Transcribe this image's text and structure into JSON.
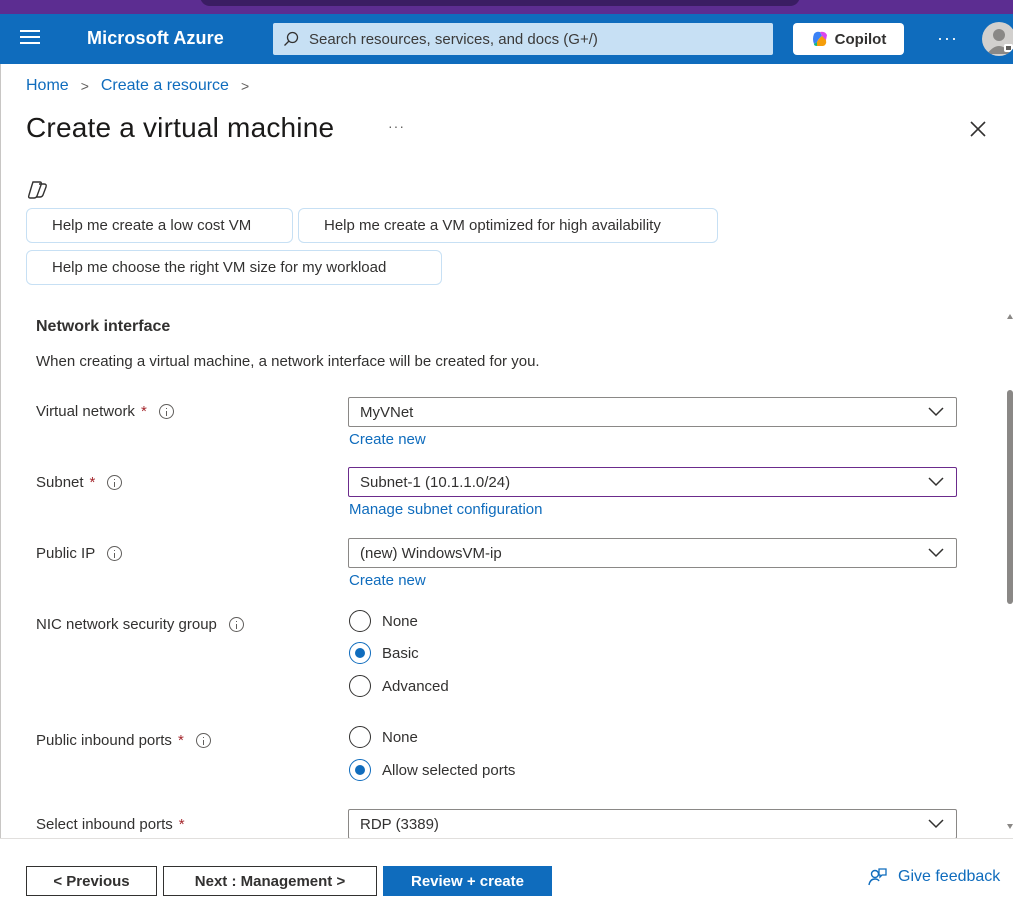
{
  "header": {
    "brand": "Microsoft Azure",
    "search_placeholder": "Search resources, services, and docs (G+/)",
    "copilot_label": "Copilot",
    "more_label": "···"
  },
  "breadcrumb": {
    "items": [
      "Home",
      "Create a resource"
    ]
  },
  "page": {
    "title": "Create a virtual machine",
    "more_label": "···"
  },
  "suggestions": [
    "Help me create a low cost VM",
    "Help me create a VM optimized for high availability",
    "Help me choose the right VM size for my workload"
  ],
  "network_interface": {
    "title": "Network interface",
    "description": "When creating a virtual machine, a network interface will be created for you.",
    "virtual_network": {
      "label": "Virtual network",
      "value": "MyVNet",
      "link": "Create new"
    },
    "subnet": {
      "label": "Subnet",
      "value": "Subnet-1 (10.1.1.0/24)",
      "link": "Manage subnet configuration"
    },
    "public_ip": {
      "label": "Public IP",
      "value": "(new) WindowsVM-ip",
      "link": "Create new"
    },
    "nic_nsg": {
      "label": "NIC network security group",
      "options": [
        "None",
        "Basic",
        "Advanced"
      ],
      "selected": "Basic"
    },
    "public_inbound_ports": {
      "label": "Public inbound ports",
      "options": [
        "None",
        "Allow selected ports"
      ],
      "selected": "Allow selected ports"
    },
    "select_inbound_ports": {
      "label": "Select inbound ports",
      "value": "RDP (3389)"
    },
    "required_mark": "*"
  },
  "footer": {
    "previous": "< Previous",
    "next": "Next : Management >",
    "review": "Review + create",
    "feedback": "Give feedback"
  },
  "colors": {
    "accent": "#0f6cbd",
    "header_bg": "#0f6cbd",
    "required": "#a4262c"
  }
}
